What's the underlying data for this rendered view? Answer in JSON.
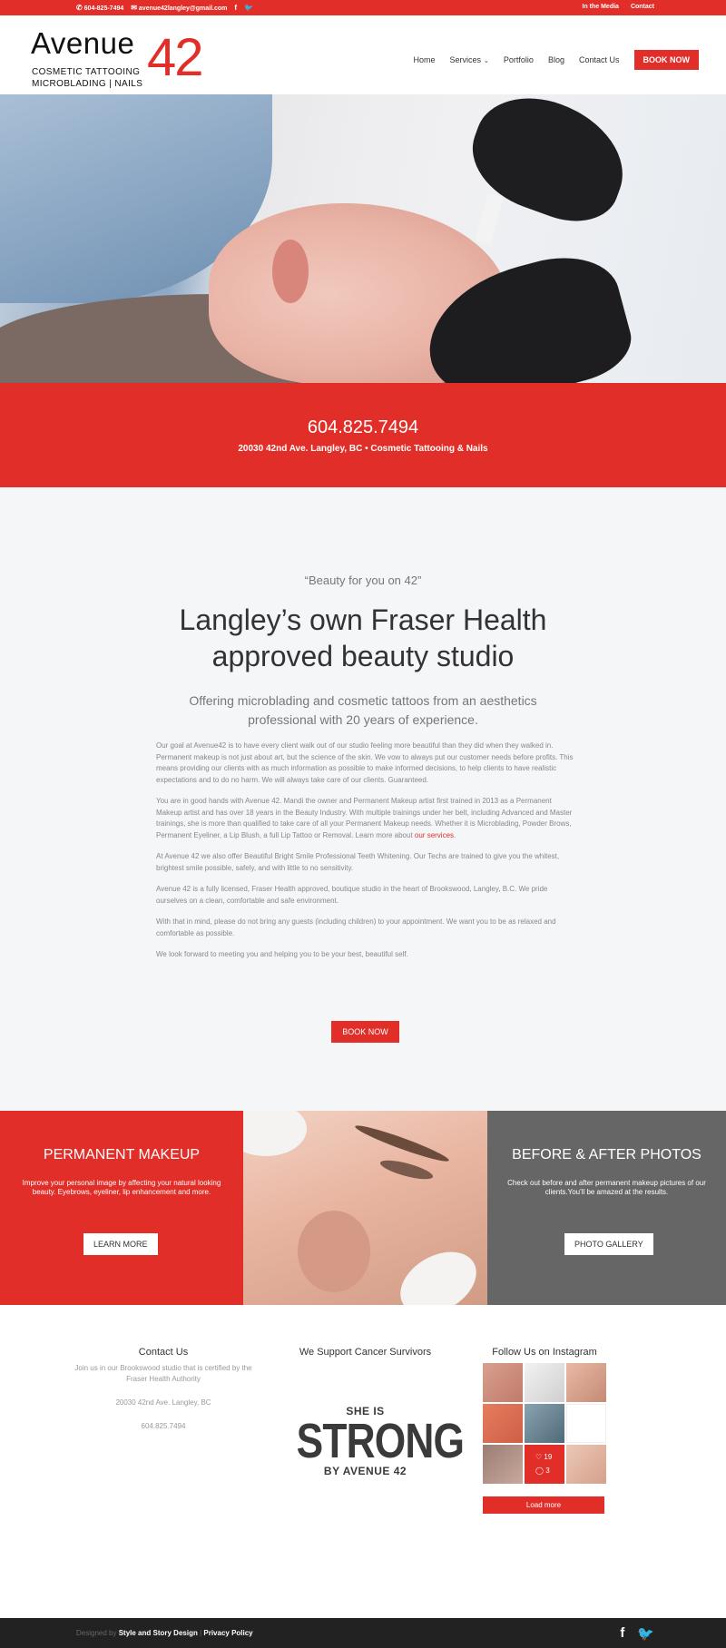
{
  "topbar": {
    "phone": "604-825-7494",
    "email": "avenue42langley@gmail.com",
    "links": [
      "In the Media",
      "Contact"
    ]
  },
  "header": {
    "logo_word": "Avenue",
    "logo_num": "42",
    "logo_sub1": "COSMETIC TATTOOING",
    "logo_sub2": "MICROBLADING | NAILS",
    "nav": [
      "Home",
      "Services",
      "Portfolio",
      "Blog",
      "Contact Us"
    ],
    "book": "BOOK NOW"
  },
  "strip": {
    "phone": "604.825.7494",
    "address": "20030 42nd Ave. Langley, BC  •  Cosmetic Tattooing & Nails"
  },
  "intro": {
    "quote": "“Beauty for you on 42”",
    "title": "Langley’s own Fraser Health approved beauty studio",
    "lead": "Offering microblading and cosmetic tattoos from an aesthetics professional with 20 years of experience.",
    "p1": "Our goal at Avenue42 is to have every client walk out of our studio feeling more beautiful than they did when they walked in. Permanent makeup is not just about art, but the science of the skin. We vow to always put our customer needs before profits. This means providing our clients with as much information as possible to make informed decisions, to help clients to have realistic expectations and to do no harm. We will always take care of our clients. Guaranteed.",
    "p2a": "You are in good hands with Avenue 42. Mandi the owner and Permanent Makeup artist first trained in 2013 as a Permanent Makeup artist and has over 18 years in the Beauty Industry.  With multiple trainings under her belt, including Advanced and Master trainings, she is more than qualified to take care of all your Permanent Makeup needs. Whether it is Microblading, Powder Brows, Permanent Eyeliner, a Lip Blush, a full Lip Tattoo or Removal. Learn more about ",
    "p2link": "our services",
    "p2b": ".",
    "p3": "At Avenue 42 we also offer Beautiful Bright Smile Professional Teeth Whitening. Our Techs are trained to give you the whitest, brightest smile possible, safely, and with little to no sensitivity.",
    "p4": "Avenue 42 is a fully licensed, Fraser Health approved, boutique studio in the heart of Brookswood, Langley, B.C. We pride ourselves on a clean, comfortable and safe environment.",
    "p5": "With that in mind, please do not bring any guests (including children) to your appointment. We want you to be as relaxed and comfortable as possible.",
    "p6": "We look forward to meeting you and helping you to be your best, beautiful self.",
    "button": "BOOK NOW"
  },
  "boxes": {
    "left_title": "PERMANENT MAKEUP",
    "left_text": "Improve your personal image by affecting your natural looking beauty. Eyebrows, eyeliner, lip enhancement and more.",
    "left_button": "LEARN MORE",
    "right_title": "BEFORE & AFTER PHOTOS",
    "right_text": "Check out before and after permanent makeup pictures of our clients.You'll be amazed at the results.",
    "right_button": "PHOTO GALLERY"
  },
  "widgets": {
    "contact_title": "Contact Us",
    "contact_text": "Join us in our Brookswood studio that is certified by the Fraser Health Authority",
    "contact_address": "20030 42nd Ave. Langley, BC",
    "contact_phone": "604.825.7494",
    "cancer_title": "We Support Cancer Survivors",
    "strong_a": "SHE IS",
    "strong_b": "STRONG",
    "strong_c": "BY AVENUE 42",
    "insta_title": "Follow Us on Instagram",
    "likes": "19",
    "comments": "3",
    "load_more": "Load more"
  },
  "bottom": {
    "designed": "Designed by ",
    "studio": "Style and Story Design",
    "sep": " | ",
    "privacy": "Privacy Policy"
  }
}
